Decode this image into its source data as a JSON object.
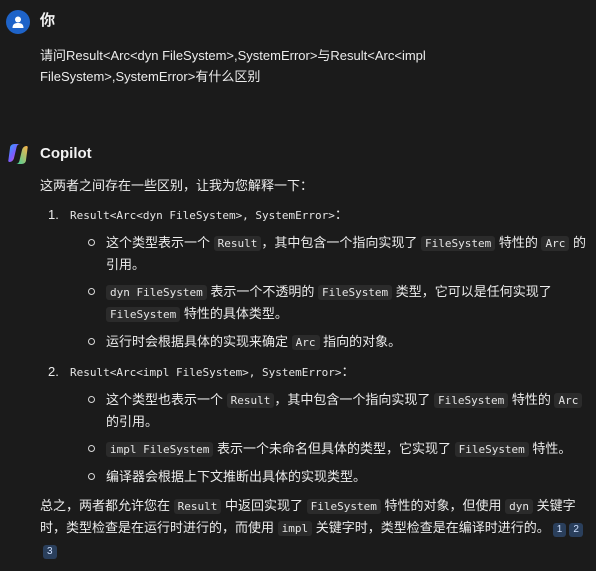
{
  "user": {
    "name": "你",
    "message_line1": "请问Result<Arc<dyn FileSystem>,SystemError>与Result<Arc<impl",
    "message_line2": "FileSystem>,SystemError>有什么区别"
  },
  "assistant": {
    "name": "Copilot",
    "intro": "这两者之间存在一些区别，让我为您解释一下：",
    "items": [
      {
        "number": "1.",
        "code": "Result<Arc<dyn FileSystem>, SystemError>",
        "colon": "：",
        "bullets": [
          {
            "t1": "这个类型表示一个 ",
            "c1": "Result",
            "t2": "，其中包含一个指向实现了 ",
            "c2": "FileSystem",
            "t3": " 特性的 ",
            "c3": "Arc",
            "t4": " 的引用。"
          },
          {
            "c1": "dyn FileSystem",
            "t1": " 表示一个不透明的 ",
            "c2": "FileSystem",
            "t2": " 类型，它可以是任何实现了 ",
            "c3": "FileSystem",
            "t3": " 特性的具体类型。"
          },
          {
            "t1": "运行时会根据具体的实现来确定 ",
            "c1": "Arc",
            "t2": " 指向的对象。"
          }
        ]
      },
      {
        "number": "2.",
        "code": "Result<Arc<impl FileSystem>, SystemError>",
        "colon": "：",
        "bullets": [
          {
            "t1": "这个类型也表示一个 ",
            "c1": "Result",
            "t2": "，其中包含一个指向实现了 ",
            "c2": "FileSystem",
            "t3": " 特性的 ",
            "c3": "Arc",
            "t4": " 的引用。"
          },
          {
            "c1": "impl FileSystem",
            "t1": " 表示一个未命名但具体的类型，它实现了 ",
            "c2": "FileSystem",
            "t2": " 特性。"
          },
          {
            "t1": "编译器会根据上下文推断出具体的实现类型。"
          }
        ]
      }
    ],
    "summary": {
      "t1": "总之，两者都允许您在 ",
      "c1": "Result",
      "t2": " 中返回实现了 ",
      "c2": "FileSystem",
      "t3": " 特性的对象，但使用 ",
      "c3": "dyn",
      "t4": " 关键字时，类型检查是在运行时进行的，而使用 ",
      "c4": "impl",
      "t5": " 关键字时，类型检查是在编译时进行的。"
    },
    "citations": [
      "1",
      "2",
      "3"
    ]
  },
  "colors": {
    "background": "#1b1b1b",
    "user_avatar": "#1e63c8",
    "citation_bg": "#2a3f5c"
  }
}
